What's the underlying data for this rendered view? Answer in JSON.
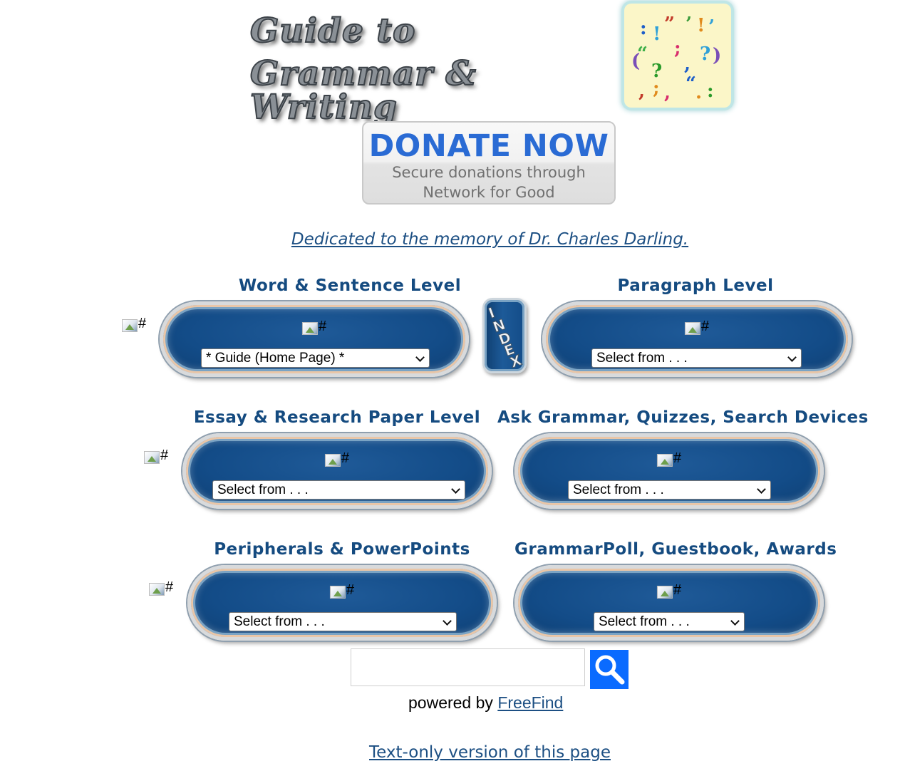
{
  "header": {
    "logo_line1": "Guide to",
    "logo_line2": "Grammar & Writing",
    "punctuation_marks": [
      ":",
      "!",
      "”",
      "’",
      "!",
      "’",
      "“",
      ";",
      "?",
      "(",
      ")",
      "?",
      ",",
      "“",
      ",",
      ":",
      ",",
      ";",
      "."
    ]
  },
  "donate": {
    "title": "DONATE NOW",
    "sub1": "Secure donations through",
    "sub2": "Network for Good"
  },
  "dedication": "Dedicated to the memory of Dr. Charles Darling.",
  "sections": {
    "word": {
      "heading": "Word & Sentence Level",
      "select": "* Guide (Home Page) *"
    },
    "paragraph": {
      "heading": "Paragraph Level",
      "select": "Select from . . ."
    },
    "essay": {
      "heading": "Essay & Research Paper Level",
      "select": "Select from . . ."
    },
    "ask": {
      "heading": "Ask Grammar, Quizzes, Search Devices",
      "select": "Select from . . ."
    },
    "peripherals": {
      "heading": "Peripherals & PowerPoints",
      "select": "Select from . . ."
    },
    "poll": {
      "heading": "GrammarPoll, Guestbook, Awards",
      "select": "Select from . . ."
    }
  },
  "broken_image_alt": "#",
  "index_letters": [
    "I",
    "N",
    "D",
    "E",
    "X"
  ],
  "search": {
    "placeholder": "",
    "powered_prefix": "powered by ",
    "powered_link": "FreeFind"
  },
  "footer": {
    "text_only": "Text-only version of this page"
  },
  "colors": {
    "heading": "#154b80",
    "link": "#1c4f83",
    "pill": "#134c88",
    "donate_title": "#2a6bd4",
    "search_button": "#0a6bff"
  }
}
